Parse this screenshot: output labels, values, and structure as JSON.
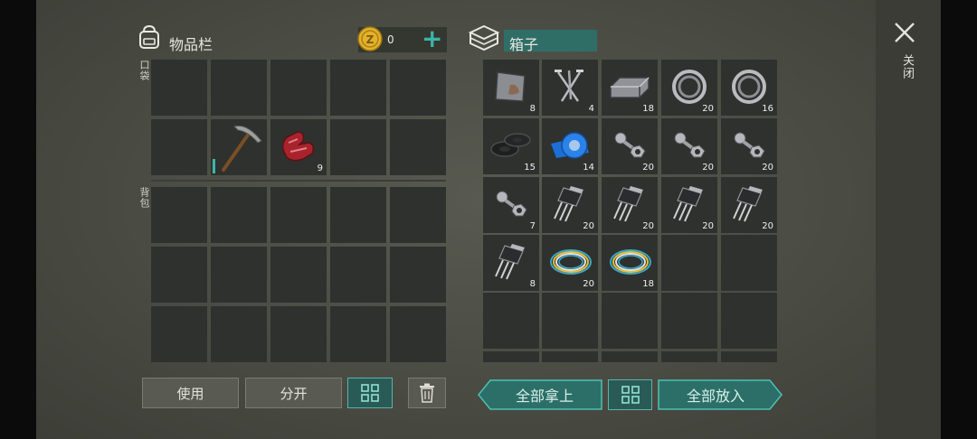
{
  "inventory": {
    "title": "物品栏",
    "coins": "0",
    "add_label": "+",
    "pocket_label": "口袋",
    "backpack_label": "背包",
    "pocket_items": [
      {
        "name": "pickaxe-icon",
        "count": ""
      },
      {
        "name": "raw-meat-icon",
        "count": "9"
      }
    ]
  },
  "box": {
    "title": "箱子",
    "items": [
      {
        "name": "metal-plate-icon",
        "count": "8"
      },
      {
        "name": "nails-icon",
        "count": "4"
      },
      {
        "name": "metal-ingot-icon",
        "count": "18"
      },
      {
        "name": "bearing-icon",
        "count": "20"
      },
      {
        "name": "bearing-icon",
        "count": "16"
      },
      {
        "name": "rubber-gasket-icon",
        "count": "15"
      },
      {
        "name": "blue-tape-icon",
        "count": "14"
      },
      {
        "name": "bolt-nut-icon",
        "count": "20"
      },
      {
        "name": "bolt-nut-icon",
        "count": "20"
      },
      {
        "name": "bolt-nut-icon",
        "count": "20"
      },
      {
        "name": "bolt-nut-icon",
        "count": "7"
      },
      {
        "name": "transistor-icon",
        "count": "20"
      },
      {
        "name": "transistor-icon",
        "count": "20"
      },
      {
        "name": "transistor-icon",
        "count": "20"
      },
      {
        "name": "transistor-icon",
        "count": "20"
      },
      {
        "name": "transistor-icon",
        "count": "8"
      },
      {
        "name": "wire-coil-icon",
        "count": "20"
      },
      {
        "name": "wire-coil-icon",
        "count": "18"
      }
    ]
  },
  "buttons": {
    "use": "使用",
    "split": "分开",
    "take_all": "全部拿上",
    "put_all": "全部放入"
  },
  "close_label": "关闭",
  "colors": {
    "accent": "#3cb4a8",
    "coin": "#e3b12a",
    "slot": "#2e312e"
  }
}
